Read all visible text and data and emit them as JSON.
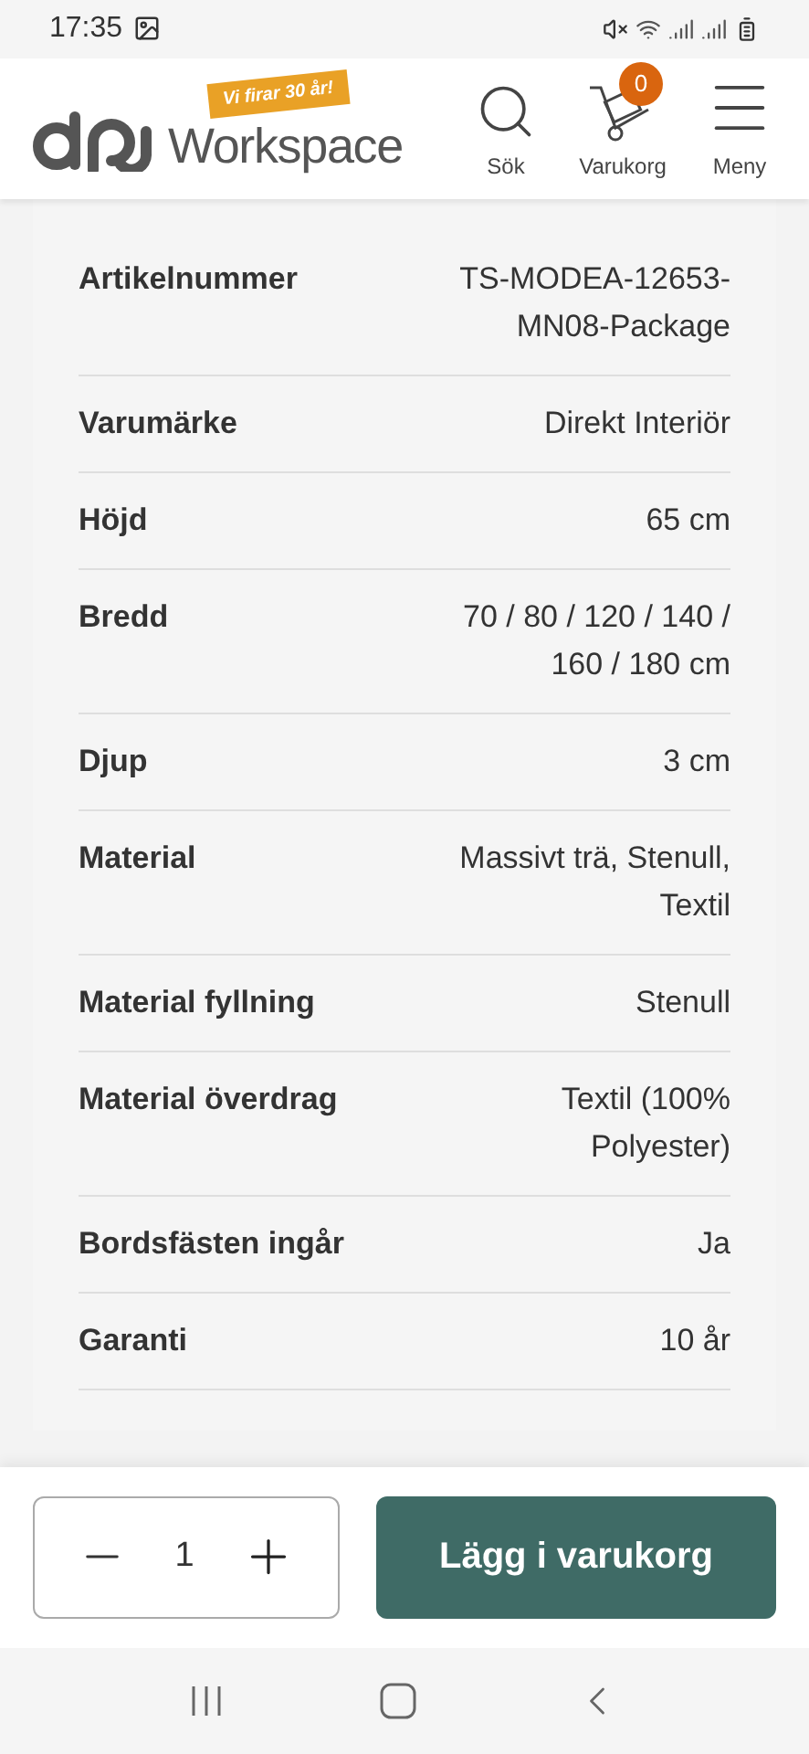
{
  "status_bar": {
    "time": "17:35"
  },
  "header": {
    "brand": "Workspace",
    "ribbon": "Vi firar 30 år!",
    "actions": [
      {
        "kind": "search",
        "label": "Sök"
      },
      {
        "kind": "cart",
        "label": "Varukorg",
        "badge": "0"
      },
      {
        "kind": "menu",
        "label": "Meny"
      }
    ]
  },
  "specs": [
    {
      "label": "Artikelnummer",
      "value": "TS-MODEA-12653-MN08-Package"
    },
    {
      "label": "Varumärke",
      "value": "Direkt Interiör"
    },
    {
      "label": "Höjd",
      "value": "65 cm"
    },
    {
      "label": "Bredd",
      "value": "70 / 80 / 120 / 140 / 160 / 180 cm"
    },
    {
      "label": "Djup",
      "value": "3 cm"
    },
    {
      "label": "Material",
      "value": "Massivt trä, Stenull, Textil"
    },
    {
      "label": "Material fyllning",
      "value": "Stenull"
    },
    {
      "label": "Material överdrag",
      "value": "Textil (100% Polyester)"
    },
    {
      "label": "Bordsfästen ingår",
      "value": "Ja"
    },
    {
      "label": "Garanti",
      "value": "10 år"
    }
  ],
  "cart_bar": {
    "quantity": "1",
    "button": "Lägg i varukorg"
  }
}
